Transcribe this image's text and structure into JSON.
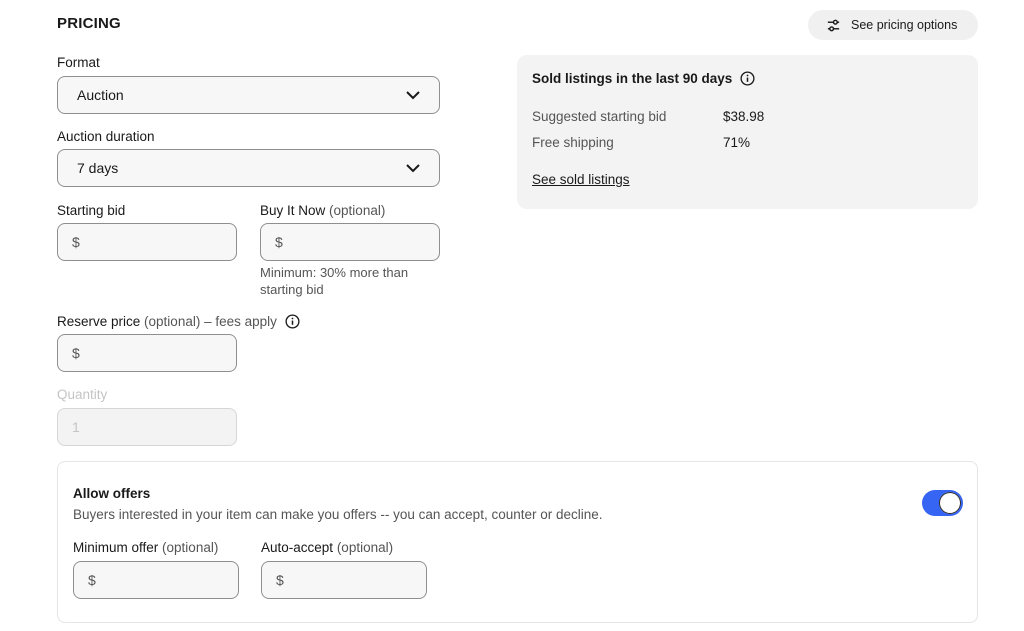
{
  "section_title": "PRICING",
  "pricing_options_button": {
    "label": "See pricing options",
    "icon": "sliders-icon"
  },
  "format": {
    "label": "Format",
    "value": "Auction"
  },
  "auction_duration": {
    "label": "Auction duration",
    "value": "7 days"
  },
  "starting_bid": {
    "label": "Starting bid",
    "prefix": "$"
  },
  "buy_it_now": {
    "label": "Buy It Now",
    "optional": "(optional)",
    "prefix": "$",
    "hint": "Minimum: 30% more than starting bid"
  },
  "reserve_price": {
    "label": "Reserve price",
    "optional": "(optional) – fees apply",
    "prefix": "$"
  },
  "quantity": {
    "label": "Quantity",
    "value": "1"
  },
  "sold_panel": {
    "title": "Sold listings in the last 90 days",
    "rows": [
      {
        "label": "Suggested starting bid",
        "value": "$38.98"
      },
      {
        "label": "Free shipping",
        "value": "71%"
      }
    ],
    "link": "See sold listings"
  },
  "offers": {
    "title": "Allow offers",
    "description": "Buyers interested in your item can make you offers -- you can accept, counter or decline.",
    "enabled": true,
    "minimum_offer": {
      "label": "Minimum offer",
      "optional": "(optional)",
      "prefix": "$"
    },
    "auto_accept": {
      "label": "Auto-accept",
      "optional": "(optional)",
      "prefix": "$"
    }
  },
  "colors": {
    "accent": "#3665f3",
    "panel_bg": "#f3f3f3",
    "input_bg": "#f7f7f7",
    "border": "#8f8f8f"
  }
}
